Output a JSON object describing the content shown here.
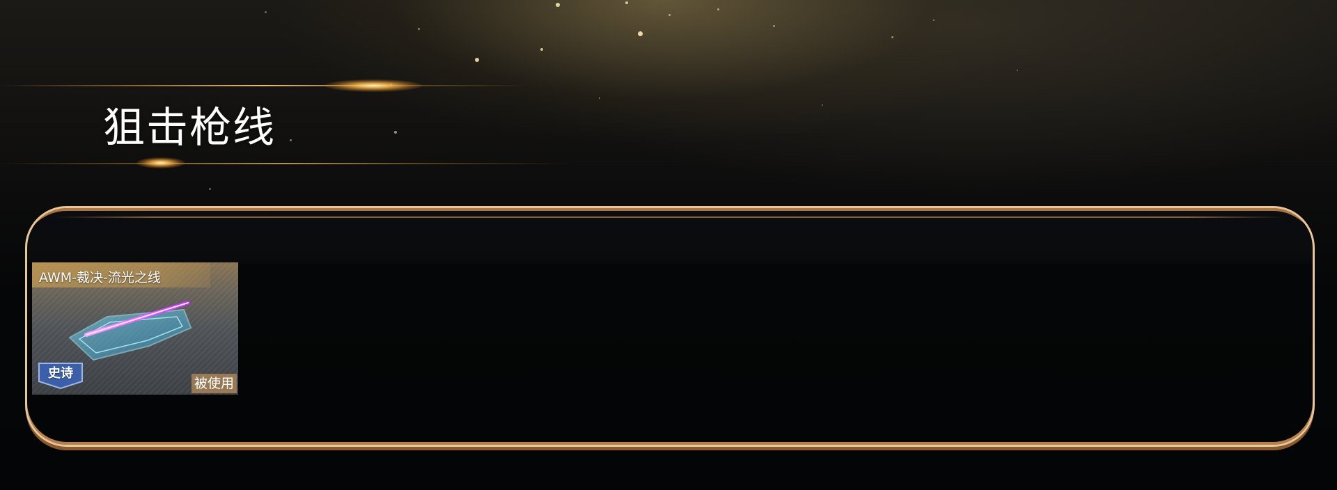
{
  "section": {
    "title": "狙击枪线"
  },
  "items": [
    {
      "name": "AWM-裁决-流光之线",
      "rarity": "史诗",
      "status": "被使用",
      "icon": "sniper-skin-image"
    }
  ],
  "colors": {
    "panel_border": "#e9c79b",
    "panel_border_dark": "#8a5a2e",
    "accent_gold": "#ffb84d",
    "rarity_blue": "#3b5fa8",
    "laser_magenta": "#e04cff",
    "gun_cyan": "#3ec3e6"
  }
}
